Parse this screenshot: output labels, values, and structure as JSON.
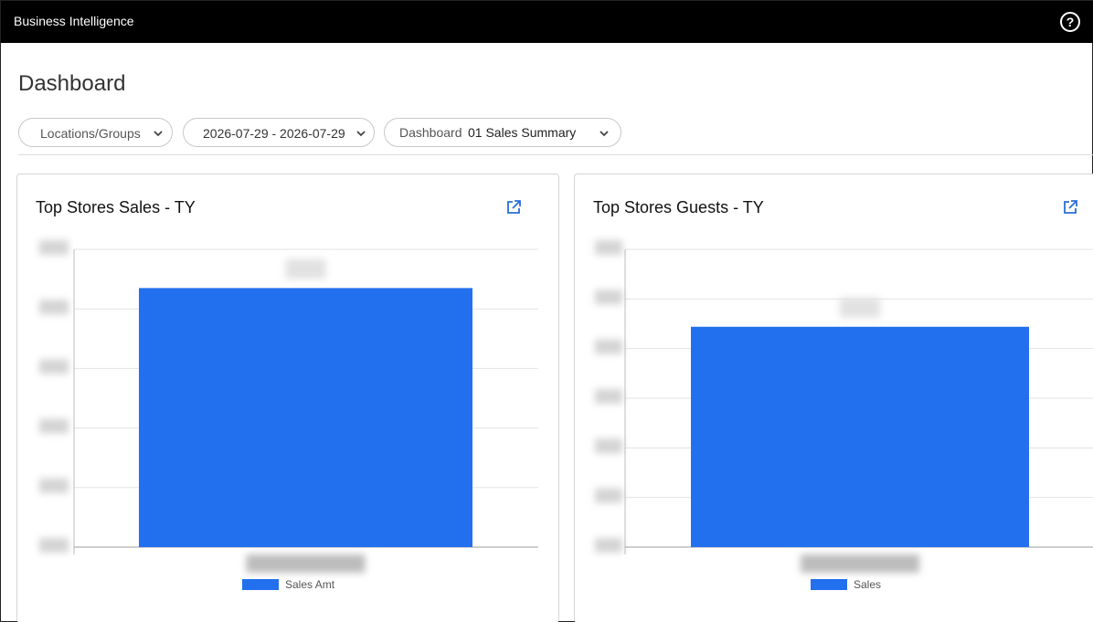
{
  "app": {
    "title": "Business Intelligence",
    "help_icon": "help-circle-icon"
  },
  "page": {
    "title": "Dashboard"
  },
  "filters": {
    "locations": "Locations/Groups",
    "date_range": "2026-07-29 - 2026-07-29",
    "dashboard_label": "Dashboard",
    "dashboard_value": "01 Sales Summary"
  },
  "colors": {
    "bar": "#2270ee",
    "topbar": "#000000"
  },
  "cards": [
    {
      "title": "Top Stores Sales - TY",
      "icon": "open-in-new-icon"
    },
    {
      "title": "Top Stores Guests - TY",
      "icon": "open-in-new-icon"
    }
  ],
  "chart_data": [
    {
      "type": "bar",
      "title": "Top Stores Sales - TY",
      "series": [
        {
          "name": "Sales Amt",
          "values": [
            0.87
          ]
        }
      ],
      "grid": true,
      "legend": "bottom",
      "note": "axis ticks, category label and data label are obscured (blurred); value given as fraction of axis max"
    },
    {
      "type": "bar",
      "title": "Top Stores Guests - TY",
      "series": [
        {
          "name": "Sales",
          "values": [
            0.74
          ]
        }
      ],
      "grid": true,
      "legend": "bottom",
      "note": "axis ticks, category label and data label are obscured (blurred); value given as fraction of axis max"
    }
  ]
}
